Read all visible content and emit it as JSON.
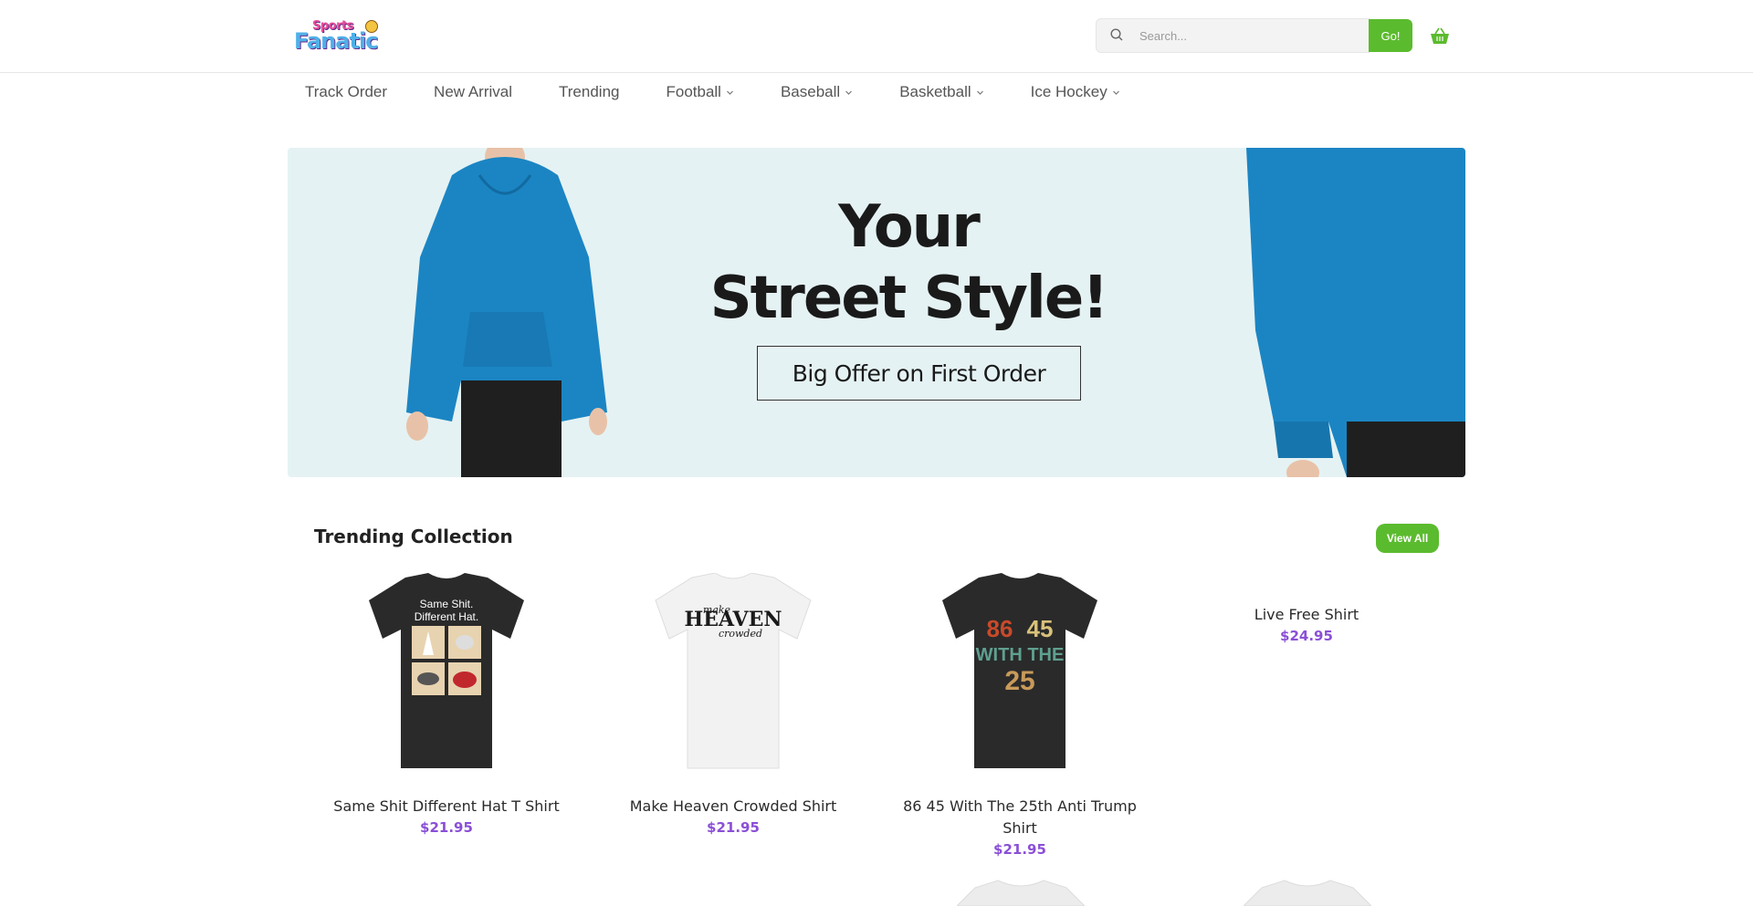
{
  "header": {
    "logo_line1": "Sports",
    "logo_line2": "Fanatic",
    "search_placeholder": "Search...",
    "go_label": "Go!"
  },
  "nav": {
    "items": [
      {
        "label": "Track Order",
        "dropdown": false
      },
      {
        "label": "New Arrival",
        "dropdown": false
      },
      {
        "label": "Trending",
        "dropdown": false
      },
      {
        "label": "Football",
        "dropdown": true
      },
      {
        "label": "Baseball",
        "dropdown": true
      },
      {
        "label": "Basketball",
        "dropdown": true
      },
      {
        "label": "Ice Hockey",
        "dropdown": true
      }
    ]
  },
  "hero": {
    "title_line1": "Your",
    "title_line2": "Street Style!",
    "offer": "Big Offer on First Order",
    "hoodie_color": "#1b85c3"
  },
  "trending": {
    "title": "Trending Collection",
    "view_all": "View All",
    "products": [
      {
        "name": "Same Shit Different Hat T Shirt",
        "price": "$21.95",
        "shirt_color": "#2a2a2a",
        "print_text": "Same Shit. Different Hat."
      },
      {
        "name": "Make Heaven Crowded Shirt",
        "price": "$21.95",
        "shirt_color": "#f2f2f2",
        "print_text": "HEAVEN"
      },
      {
        "name": "86 45 With The 25th Anti Trump Shirt",
        "price": "$21.95",
        "shirt_color": "#2a2a2a",
        "print_text": "86 45 WITH THE 25TH"
      },
      {
        "name": "Live Free Shirt",
        "price": "$24.95"
      }
    ]
  },
  "colors": {
    "accent_green": "#5bbb2e",
    "price_purple": "#8a4fd6",
    "hero_bg": "#e5f2f3"
  }
}
